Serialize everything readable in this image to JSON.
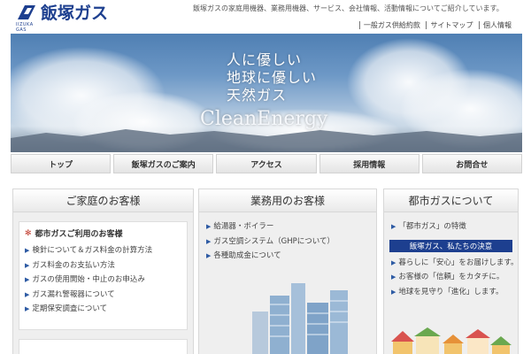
{
  "header": {
    "logo_name": "飯塚ガス",
    "logo_sub": "IIZUKA GAS",
    "tagline": "飯塚ガスの家庭用機器、業務用機器、サービス、会社情報、活動情報についてご紹介しています。",
    "util_links": [
      "一般ガス供給約款",
      "サイトマップ",
      "個人情報"
    ]
  },
  "hero": {
    "lines": [
      "人に優しい",
      "地球に優しい",
      "天然ガス"
    ],
    "english": "CleanEnergy"
  },
  "nav": {
    "items": [
      "トップ",
      "飯塚ガスのご案内",
      "アクセス",
      "採用情報",
      "お問合せ"
    ]
  },
  "home": {
    "title": "ご家庭のお客様",
    "box_title": "都市ガスご利用のお客様",
    "links": [
      "検針について＆ガス料金の計算方法",
      "ガス料金のお支払い方法",
      "ガスの使用開始・中止のお申込み",
      "ガス漏れ警報器について",
      "定期保安調査について"
    ]
  },
  "business": {
    "title": "業務用のお客様",
    "links": [
      "給湯器・ボイラー",
      "ガス空調システム（GHPについて）",
      "各種助成金について"
    ]
  },
  "citygas": {
    "title": "都市ガスについて",
    "link": "「都市ガス」の特徴",
    "banner": "飯塚ガス、私たちの決意",
    "links": [
      "暮らしに「安心」をお届けします。",
      "お客様の「信頼」をカタチに。",
      "地球を見守り「進化」します。"
    ]
  }
}
